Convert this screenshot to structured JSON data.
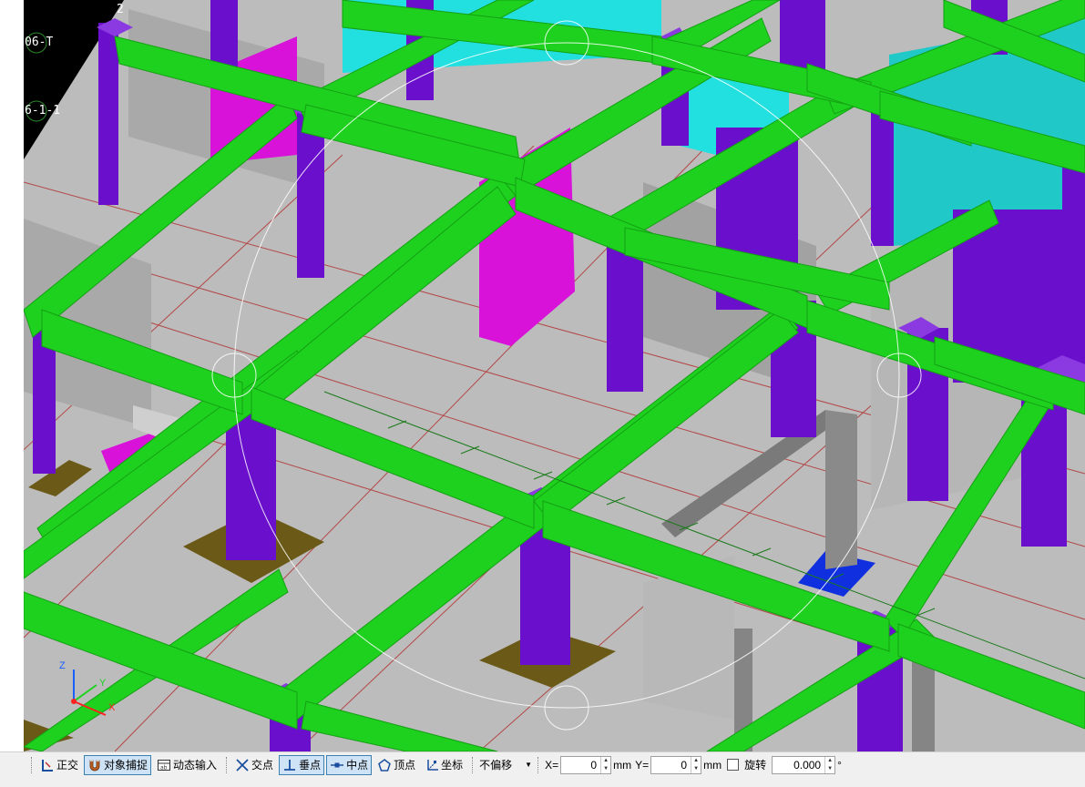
{
  "viewport": {
    "axis_labels": [
      "2",
      "06-T",
      "6-1-1"
    ],
    "gizmo": {
      "x": "X",
      "y": "Y",
      "z": "Z"
    }
  },
  "colors": {
    "beam": "#1ed11e",
    "column": "#6a10cc",
    "wall": "#c4c4c4",
    "magenta": "#d812d8",
    "cyan": "#23e0e0",
    "floor": "#bcbcbc",
    "footing": "#6b5a17",
    "grid_line": "#b02020",
    "active_bg": "#cfe3f7"
  },
  "toolbar": {
    "ortho": "正交",
    "snap": "对象捕捉",
    "dynamic_input": "动态输入",
    "intersection": "交点",
    "perpendicular": "垂点",
    "midpoint": "中点",
    "vertex": "顶点",
    "coordinate": "坐标",
    "offset_mode": "不偏移",
    "x_label": "X=",
    "x_value": "0",
    "x_unit": "mm",
    "y_label": "Y=",
    "y_value": "0",
    "y_unit": "mm",
    "rotate_label": "旋转",
    "rotate_value": "0.000",
    "degree": "°"
  }
}
